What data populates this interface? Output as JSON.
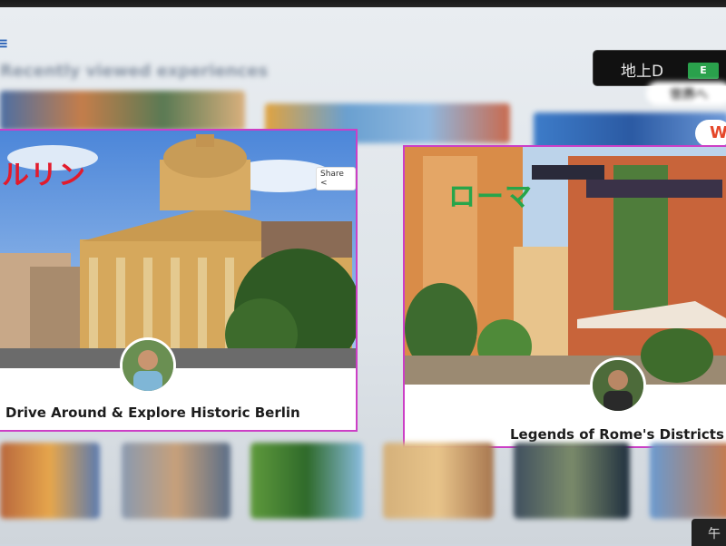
{
  "section": {
    "title": "Recently viewed experiences"
  },
  "tv_overlay": {
    "label": "地上D",
    "channel": "E"
  },
  "top_right_pill": {
    "label": "世界へ"
  },
  "top_right_pill2": {
    "label": "W"
  },
  "cards": [
    {
      "city": "ルリン",
      "title": "Drive Around & Explore Historic Berlin",
      "share": "Share"
    },
    {
      "city": "ローマ",
      "title": "Legends of Rome's Districts"
    }
  ],
  "corner_text": "午",
  "colors": {
    "card_border": "#cc3fc6",
    "berlin_label": "#e21b2c",
    "rome_label": "#27a54a"
  },
  "icons": [
    "menu-icon",
    "share-icon"
  ]
}
